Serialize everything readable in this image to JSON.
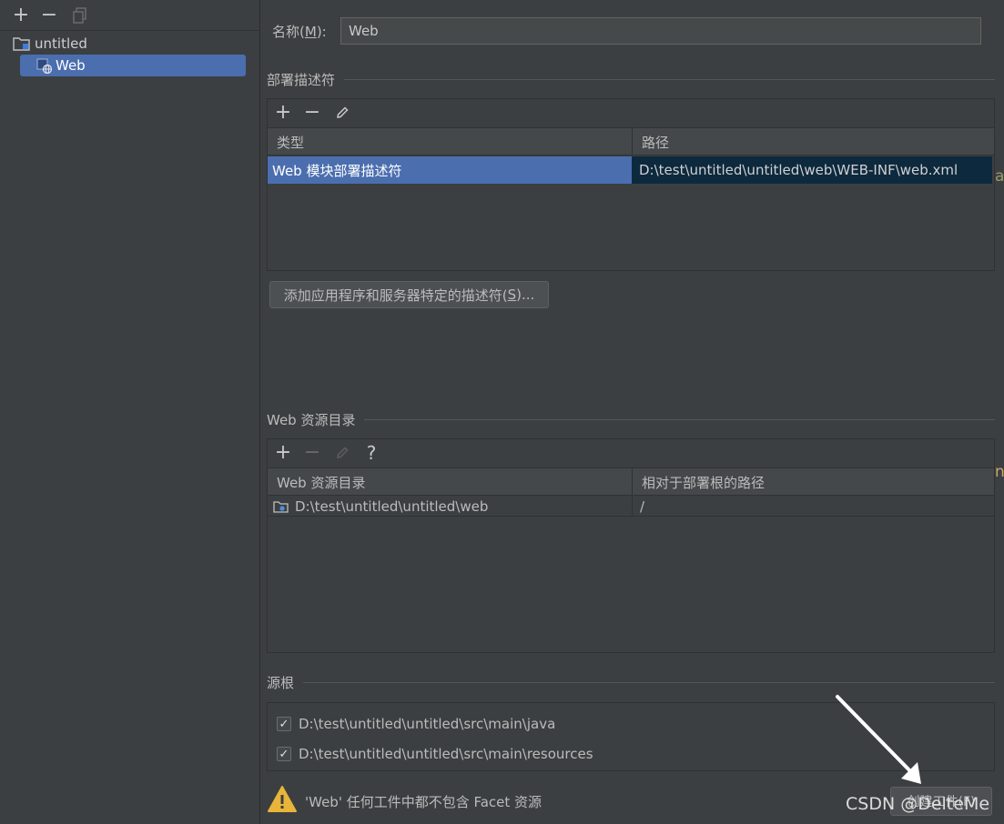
{
  "tree": {
    "toolbar": {
      "add": "+",
      "remove": "−"
    },
    "items": [
      {
        "label": "untitled"
      },
      {
        "label": "Web"
      }
    ]
  },
  "name_field": {
    "label_pre": "名称(",
    "label_key": "M",
    "label_post": "):",
    "value": "Web"
  },
  "deploy": {
    "title": "部署描述符",
    "toolbar": {
      "add": "+",
      "remove": "−"
    },
    "columns": [
      "类型",
      "路径"
    ],
    "rows": [
      {
        "type": "Web 模块部署描述符",
        "path": "D:\\test\\untitled\\untitled\\web\\WEB-INF\\web.xml"
      }
    ],
    "add_button": {
      "pre": "添加应用程序和服务器特定的描述符(",
      "key": "S",
      "post": ")..."
    }
  },
  "web_resources": {
    "title": "Web 资源目录",
    "toolbar": {
      "add": "+",
      "remove": "−",
      "help": "?"
    },
    "columns": [
      "Web 资源目录",
      "相对于部署根的路径"
    ],
    "rows": [
      {
        "dir": "D:\\test\\untitled\\untitled\\web",
        "relative": "/"
      }
    ]
  },
  "source_roots": {
    "title": "源根",
    "items": [
      {
        "checked": "✓",
        "path": "D:\\test\\untitled\\untitled\\src\\main\\java"
      },
      {
        "checked": "✓",
        "path": "D:\\test\\untitled\\untitled\\src\\main\\resources"
      }
    ]
  },
  "warning": {
    "text": "'Web' 任何工件中都不包含 Facet 资源"
  },
  "create_artifact": {
    "label": "创建工件(F)"
  },
  "watermark": "CSDN @DelteMe",
  "colors": {
    "selection": "#4b6eaf",
    "background": "#3c3f41",
    "warning": "#e8b53a"
  },
  "edge_letters": [
    "a",
    "n"
  ]
}
